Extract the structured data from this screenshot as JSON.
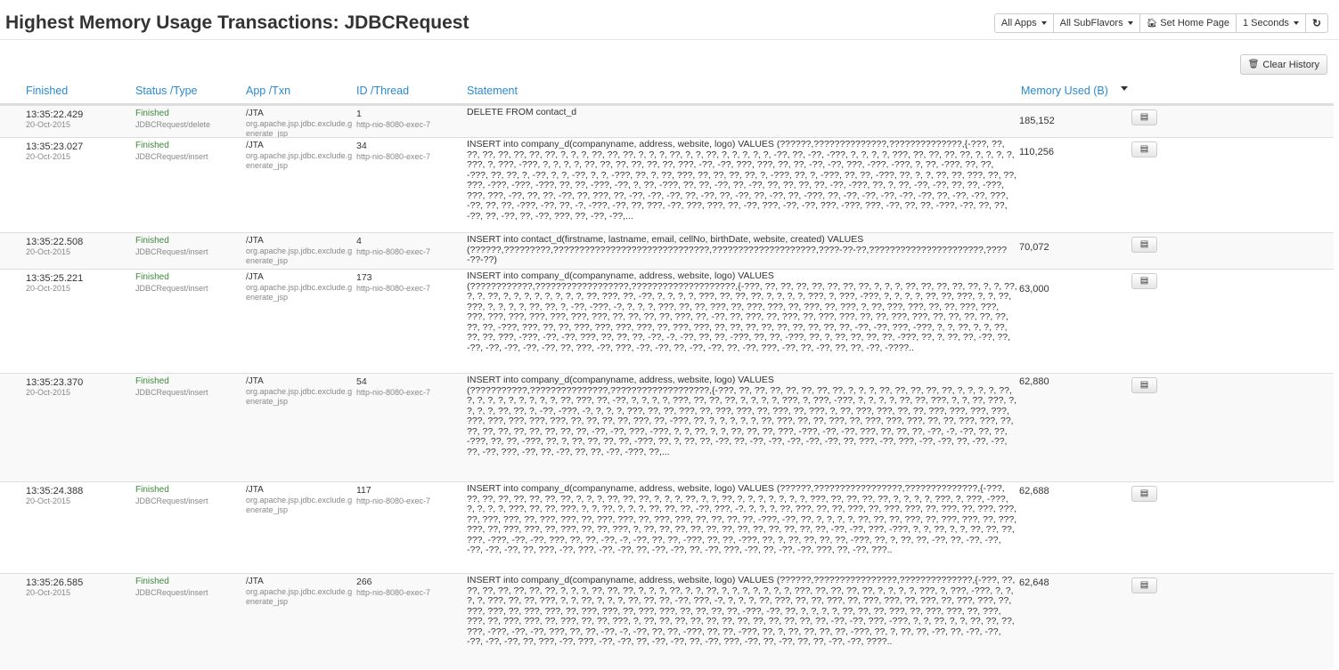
{
  "page": {
    "title": "Highest Memory Usage Transactions: JDBCRequest"
  },
  "toolbar": {
    "apps_label": "All Apps",
    "subflavors_label": "All SubFlavors",
    "home_label": "Set Home Page",
    "interval_label": "1 Seconds",
    "home_icon": "home-icon",
    "refresh_icon": "refresh-icon"
  },
  "clear_history_label": "Clear History",
  "columns": {
    "finished": "Finished",
    "status": "Status /Type",
    "app": "App /Txn",
    "id": "ID /Thread",
    "statement": "Statement",
    "memory": "Memory Used (B)"
  },
  "colors": {
    "link": "#2a8bd0",
    "status_ok": "#3c8a3c",
    "muted": "#888888"
  },
  "rows": [
    {
      "time": "13:35:22.429",
      "date": "20-Oct-2015",
      "status": "Finished",
      "type": "JDBCRequest/delete",
      "app": "/JTA",
      "txn": "org.apache.jsp.jdbc.exclude.generate_jsp",
      "id": "1",
      "thread": "http-nio-8080-exec-7",
      "statement": "DELETE FROM contact_d",
      "memory": "185,152"
    },
    {
      "time": "13:35:23.027",
      "date": "20-Oct-2015",
      "status": "Finished",
      "type": "JDBCRequest/insert",
      "app": "/JTA",
      "txn": "org.apache.jsp.jdbc.exclude.generate_jsp",
      "id": "34",
      "thread": "http-nio-8080-exec-7",
      "statement": "INSERT into company_d(companyname, address, website, logo) VALUES (??????,??????????????,??????????????,{-???, ??, ??, ??, ??, ??, ??, ??, ?, ?, ?, ??, ??, ??, ?, ?, ?, ??, ?, ?, ??, ?, ?, ?, ?, ?, -??, ??, -??, -???, ?, ?, ?, ?, ???, ??, ??, ??, ??, ?, ?, ?, ?, ???, ?, ???, -???, ?, ?, ?, ?, ??, ??, ??, ??, ??, ??, ???, -??, -??, ???, ???, ??, ??, -??, -??, ???, -???, -???, ?, ??, -???, ??, ??, -???, ??, ??, ?, -??, ?, ?, -??, ?, ?, -???, ??, ?, ??, ???, ??, ??, ??, ??, ?, -???, ??, ?, -???, ??, ??, -???, ??, ?, ?, ??, ??, ???, ??, ??, ???, -???, -???, -???, ??, ??, -???, -??, ?, ??, -???, ??, ??, -??, ??, -??, ??, ??, ??, ??, -??, -???, ??, ?, ??, -??, -??, ??, ??, -???, ???, ???, -??, ??, ??, -??, ??, ???, ??, -??, -??, -??, ??, -??, ??, -??, ??, -??, ??, -???, ??, -??, -??, -??, -??, -??, ??, -??, -??, ???, -??, ??, ??, -???, -??, ??, -?, -???, -??, ??, ???, -??, ???, ???, ??, -??, ???, -??, -??, ???, -???, ???, -??, ??, ??, -???, -??, ??, ??, -??, ??, -??, ??, -??, ???, ??, -??, -??,...",
      "memory": "110,256"
    },
    {
      "time": "13:35:22.508",
      "date": "20-Oct-2015",
      "status": "Finished",
      "type": "JDBCRequest/insert",
      "app": "/JTA",
      "txn": "org.apache.jsp.jdbc.exclude.generate_jsp",
      "id": "4",
      "thread": "http-nio-8080-exec-7",
      "statement": "INSERT into contact_d(firstname, lastname, email, cellNo, birthDate, website, created) VALUES (??????,?????????,??????????????????????????????,????????????????????,????-??-??,??????????????????????,????-??-??)",
      "memory": "70,072"
    },
    {
      "time": "13:35:25.221",
      "date": "20-Oct-2015",
      "status": "Finished",
      "type": "JDBCRequest/insert",
      "app": "/JTA",
      "txn": "org.apache.jsp.jdbc.exclude.generate_jsp",
      "id": "173",
      "thread": "http-nio-8080-exec-7",
      "statement": "INSERT into company_d(companyname, address, website, logo) VALUES (????????????,??????????????????,????????????????????,{-???, ??, ??, ??, ??, ??, ??, ??, ?, ?, ?, ??, ??, ??, ??, ??, ?, ?, ??, ?, ?, ??, ?, ?, ?, ?, ?, ?, ?, ?, ??, ???, ??, -??, ?, ?, ?, ?, ???, ??, ??, ??, ?, ?, ?, ?, ???, ?, ???, -???, ?, ?, ?, ?, ??, ??, ???, ?, ?, ??, ???, ?, ?, ?, ?, ??, ??, ?, -??, -???, -?, ?, ?, ?, ???, ??, ??, ???, ??, ???, ???, ??, ???, ??, ???, ?, ??, ???, ???, ??, ??, ???, ???, ???, ???, ???, ???, ???, ???, ???, ??, ??, ??, ??, ???, ??, -??, ??, ???, ??, ???, ??, ???, ???, ??, ??, ???, ???, ??, ??, ??, ??, ??, ??, ??, -???, ???, ??, ??, ???, ???, ???, ???, ??, ???, ???, ??, ??, ??, ??, ??, ??, ??, ??, ??, -??, -??, ???, -???, ?, ?, ??, ?, ?, ??, ??, ??, ???, -???, -??, -??, ???, ??, ??, ??, -??, -?, -??, ??, ??, -???, ??, ??, -???, ??, ?, ??, ??, ??, ??, -???, ??, ?, ??, ??, -??, ??, -??, -??, -??, -??, -??, ??, ???, -??, ???, -??, -??, ??, -??, -??, ??, -??, ???, -??, ??, -??, ??, ??, -??, -????..",
      "memory": "63,000"
    },
    {
      "time": "13:35:23.370",
      "date": "20-Oct-2015",
      "status": "Finished",
      "type": "JDBCRequest/insert",
      "app": "/JTA",
      "txn": "org.apache.jsp.jdbc.exclude.generate_jsp",
      "id": "54",
      "thread": "http-nio-8080-exec-7",
      "statement": "INSERT into company_d(companyname, address, website, logo) VALUES (???????????,???????????????,???????????????????,{-???, ??, ??, ??, ??, ??, ??, ??, ?, ?, ?, ??, ??, ??, ??, ??, ?, ?, ?, ?, ??, ?, ?, ?, ?, ?, ?, ?, ?, ?, ??, ???, ??, -??, ?, ?, ?, ?, ???, ??, ??, ??, ?, ?, ?, ?, ???, ?, ???, -???, ?, ?, ?, ?, ??, ??, ???, ?, ?, ??, ???, ?, ?, ?, ?, ??, ??, ?, -??, -???, -?, ?, ?, ?, ???, ??, ??, ???, ??, ???, ???, ??, ???, ??, ???, ?, ??, ???, ???, ??, ??, ???, ???, ???, ???, ???, ???, ???, ???, ???, ??, ??, ??, ??, ???, ??, -???, ??, ?, ?, ?, ?, ?, ??, ???, ??, ??, ???, ??, ???, ???, ???, ??, ??, ???, ???, ??, ??, ??, ??, ??, ??, ??, ??, ??, -??, -??, ???, -???, ?, ?, ??, ?, ?, ??, ??, ??, ???, -???, -??, -??, ???, ??, ??, ??, -??, -?, -??, ??, ??, -???, ??, ??, -???, ??, ?, ??, ??, ??, ??, -???, ??, ?, ??, ??, -??, ??, -??, -??, -??, -??, -??, ??, ???, -??, ???, -??, -??, ??, -??, -??, ??, -??, ???, -??, ??, -??, ??, ??, -??, -???, ??,...",
      "memory": "62,880"
    },
    {
      "time": "13:35:24.388",
      "date": "20-Oct-2015",
      "status": "Finished",
      "type": "JDBCRequest/insert",
      "app": "/JTA",
      "txn": "org.apache.jsp.jdbc.exclude.generate_jsp",
      "id": "117",
      "thread": "http-nio-8080-exec-7",
      "statement": "INSERT into company_d(companyname, address, website, logo) VALUES (??????,?????????????????,??????????????,{-???, ??, ??, ??, ??, ??, ??, ??, ?, ?, ?, ??, ??, ??, ?, ?, ?, ??, ?, ?, ??, ?, ?, ?, ?, ?, ?, ?, ???, ??, ??, ??, ??, ?, ?, ?, ?, ???, ?, ???, -???, ?, ?, ?, ?, ???, ??, ??, ???, ?, ?, ??, ?, ?, ?, ??, ??, ??, -??, ???, -?, ?, ?, ?, ??, ???, ??, ??, ???, ??, ???, ???, ??, ???, ??, ???, ???, ??, ???, ???, ??, ???, ???, ??, ???, ???, ??, ???, ???, ??, ??, ??, ??, -???, -??, ??, ?, ?, ?, ?, ??, ??, ??, ???, ??, ???, ???, ??, ???, ???, ??, ???, ???, ??, ???, ??, ??, ???, ?, ??, ??, ??, ??, ??, ??, ??, ??, ??, ??, ??, ??, -??, -??, ???, -???, ?, ?, ??, ?, ?, ??, ??, ??, ???, -???, -??, -??, ???, ??, ??, -??, -?, -??, ??, ??, -???, ??, ??, -???, ??, ?, ??, ??, ??, ??, -???, ??, ?, ??, ??, -??, ??, -??, -??, -??, -??, -??, ??, ???, -??, ???, -??, -??, ??, -??, -??, ??, -??, ???, -??, ??, -??, -??, ???, ??, -??, ???..",
      "memory": "62,688"
    },
    {
      "time": "13:35:26.585",
      "date": "20-Oct-2015",
      "status": "Finished",
      "type": "JDBCRequest/insert",
      "app": "/JTA",
      "txn": "org.apache.jsp.jdbc.exclude.generate_jsp",
      "id": "266",
      "thread": "http-nio-8080-exec-7",
      "statement": "INSERT into company_d(companyname, address, website, logo) VALUES (??????,????????????????,??????????????,{-???, ??, ??, ??, ??, ??, ??, ??, ?, ?, ?, ??, ??, ??, ?, ?, ?, ??, ?, ?, ??, ?, ?, ?, ?, ?, ?, ?, ???, ??, ??, ??, ??, ?, ?, ?, ?, ???, ?, ???, -???, ?, ?, ?, ?, ???, ??, ??, ???, ?, ?, ??, ?, ?, ?, ??, ??, ??, -??, ???, -?, ?, ?, ?, ??, ???, ??, ??, ???, ??, ???, ???, ??, ???, ??, ???, ???, ??, ???, ???, ??, ???, ???, ??, ???, ???, ??, ???, ???, ??, ??, ??, ??, -???, -??, ??, ?, ?, ?, ?, ??, ??, ??, ???, ??, ???, ???, ??, ???, ???, ??, ???, ???, ??, ???, ??, ??, ???, ?, ??, ??, ??, ??, ??, ??, ??, ??, ??, ??, ??, ??, -??, -??, ???, -???, ?, ?, ??, ?, ?, ??, ??, ??, ???, -???, -??, -??, ???, ??, ??, -??, -?, -??, ??, ??, -???, ??, ??, -???, ??, ?, ??, ??, ??, ??, -???, ??, ?, ??, ??, -??, ??, -??, -??, -??, -??, -??, ??, ???, -??, ???, -??, -??, ??, -??, -??, ??, -??, ???, -??, ??, -??, ??, ??, -??, -??, ????..",
      "memory": "62,648"
    }
  ]
}
